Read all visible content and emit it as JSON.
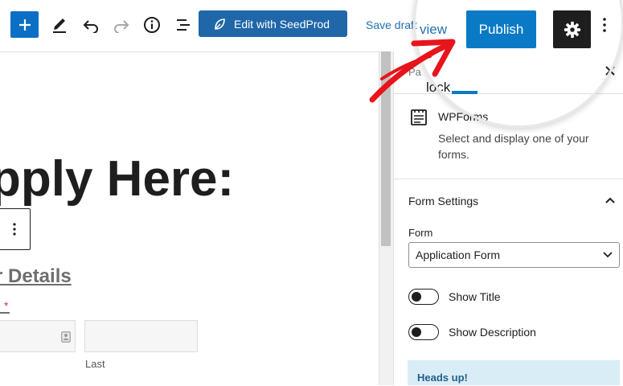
{
  "toolbar": {
    "seedprod_label": "Edit with SeedProd",
    "save_draft_label": "Save draft",
    "preview_label": "view",
    "publish_label": "Publish",
    "icons": [
      "plus-icon",
      "pen-icon",
      "undo-icon",
      "redo-icon",
      "info-icon",
      "list-view-icon",
      "seedprod-leaf-icon",
      "gear-icon",
      "kebab-menu-icon"
    ]
  },
  "editor": {
    "heading": "pply Here:",
    "subheading": "r Details",
    "required_marker": "*",
    "name_field_last_label": "Last"
  },
  "sidebar": {
    "tab_page": "Pa",
    "tab_block": "lock",
    "block": {
      "title": "WPForms",
      "description": "Select and display one of your forms."
    },
    "form_settings": {
      "title": "Form Settings",
      "form_label": "Form",
      "form_value": "Application Form",
      "show_title_label": "Show Title",
      "show_title_on": false,
      "show_description_label": "Show Description",
      "show_description_on": false
    },
    "notice_title": "Heads up!"
  },
  "colors": {
    "accent": "#0a7ac6",
    "seedprod": "#1f67a8",
    "arrow": "#e8141b",
    "notice_bg": "#d9edf7"
  }
}
